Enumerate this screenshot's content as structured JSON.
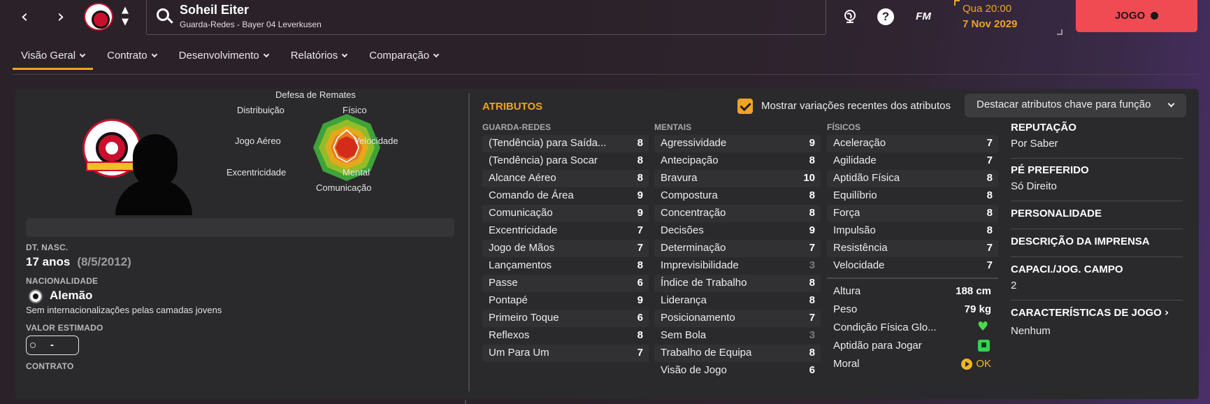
{
  "header": {
    "player_name": "Soheil Eiter",
    "player_subtitle": "Guarda-Redes - Bayer 04 Leverkusen",
    "date_time": "Qua 20:00",
    "date_day": "7 Nov 2029",
    "continue_label": "JOGO",
    "fm_label": "FM",
    "help_label": "?",
    "icons": [
      "back-icon",
      "forward-icon",
      "club-badge",
      "search-icon",
      "world-icon",
      "help-icon",
      "fm-icon"
    ]
  },
  "tabs": [
    {
      "label": "Visão Geral",
      "active": true
    },
    {
      "label": "Contrato",
      "active": false
    },
    {
      "label": "Desenvolvimento",
      "active": false
    },
    {
      "label": "Relatórios",
      "active": false
    },
    {
      "label": "Comparação",
      "active": false
    }
  ],
  "radar": {
    "labels": [
      "Defesa de Remates",
      "Físico",
      "Velocidade",
      "Mental",
      "Comunicação",
      "Excentricidade",
      "Jogo Aéreo",
      "Distribuição"
    ]
  },
  "bio": {
    "dob_label": "DT. NASC.",
    "age": "17 anos",
    "dob": "(8/5/2012)",
    "nationality_label": "NACIONALIDADE",
    "nationality": "Alemão",
    "youth_caps": "Sem internacionalizações pelas camadas jovens",
    "value_label": "VALOR ESTIMADO",
    "value": "-",
    "contract_label": "CONTRATO"
  },
  "attributes": {
    "title": "ATRIBUTOS",
    "show_changes_label": "Mostrar variações recentes dos atributos",
    "show_changes_checked": true,
    "highlight_label": "Destacar atributos chave para função",
    "goalkeeping": {
      "heading": "GUARDA-REDES",
      "items": [
        {
          "name": "(Tendência) para Saída...",
          "value": "8"
        },
        {
          "name": "(Tendência) para Socar",
          "value": "8"
        },
        {
          "name": "Alcance Aéreo",
          "value": "8"
        },
        {
          "name": "Comando de Área",
          "value": "9"
        },
        {
          "name": "Comunicação",
          "value": "9"
        },
        {
          "name": "Excentricidade",
          "value": "7"
        },
        {
          "name": "Jogo de Mãos",
          "value": "7"
        },
        {
          "name": "Lançamentos",
          "value": "8"
        },
        {
          "name": "Passe",
          "value": "6"
        },
        {
          "name": "Pontapé",
          "value": "9"
        },
        {
          "name": "Primeiro Toque",
          "value": "6"
        },
        {
          "name": "Reflexos",
          "value": "8"
        },
        {
          "name": "Um Para Um",
          "value": "7"
        }
      ]
    },
    "mental": {
      "heading": "MENTAIS",
      "items": [
        {
          "name": "Agressividade",
          "value": "9"
        },
        {
          "name": "Antecipação",
          "value": "8"
        },
        {
          "name": "Bravura",
          "value": "10"
        },
        {
          "name": "Compostura",
          "value": "8"
        },
        {
          "name": "Concentração",
          "value": "8"
        },
        {
          "name": "Decisões",
          "value": "9"
        },
        {
          "name": "Determinação",
          "value": "7"
        },
        {
          "name": "Imprevisibilidade",
          "value": "3"
        },
        {
          "name": "Índice de Trabalho",
          "value": "8"
        },
        {
          "name": "Liderança",
          "value": "8"
        },
        {
          "name": "Posicionamento",
          "value": "7"
        },
        {
          "name": "Sem Bola",
          "value": "3"
        },
        {
          "name": "Trabalho de Equipa",
          "value": "8"
        },
        {
          "name": "Visão de Jogo",
          "value": "6"
        }
      ]
    },
    "physical": {
      "heading": "FÍSICOS",
      "items": [
        {
          "name": "Aceleração",
          "value": "7"
        },
        {
          "name": "Agilidade",
          "value": "7"
        },
        {
          "name": "Aptidão Física",
          "value": "8"
        },
        {
          "name": "Equilíbrio",
          "value": "8"
        },
        {
          "name": "Força",
          "value": "8"
        },
        {
          "name": "Impulsão",
          "value": "8"
        },
        {
          "name": "Resistência",
          "value": "7"
        },
        {
          "name": "Velocidade",
          "value": "7"
        }
      ]
    }
  },
  "physical_info": {
    "height_label": "Altura",
    "height": "188 cm",
    "weight_label": "Peso",
    "weight": "79 kg",
    "condition_label": "Condição Física Glo...",
    "match_fitness_label": "Aptidão para Jogar",
    "morale_label": "Moral",
    "morale_value": "OK"
  },
  "info": {
    "reputation_label": "REPUTAÇÃO",
    "reputation": "Por Saber",
    "foot_label": "PÉ PREFERIDO",
    "foot": "Só Direito",
    "personality_label": "PERSONALIDADE",
    "media_label": "DESCRIÇÃO DA IMPRENSA",
    "ability_label": "CAPACI./JOG. CAMPO",
    "ability": "2",
    "traits_label": "CARACTERÍSTICAS DE JOGO",
    "traits": "Nenhum"
  },
  "colors": {
    "accent": "#f0a325",
    "continue_button": "#f04b52",
    "panel": "#2a2a2c"
  }
}
